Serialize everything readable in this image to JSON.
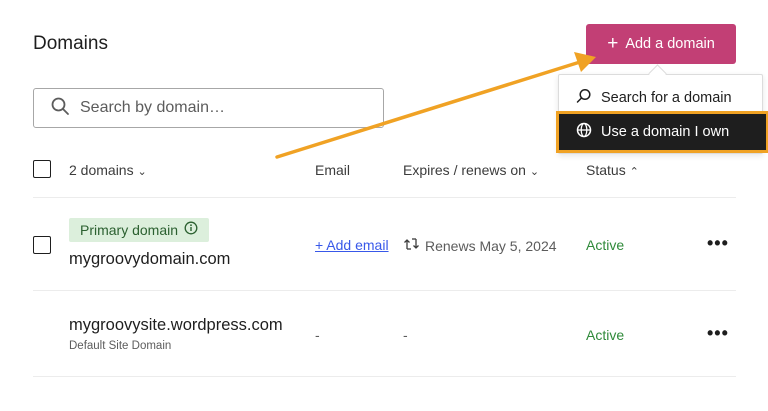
{
  "page": {
    "title": "Domains"
  },
  "add_button": {
    "label": "Add a domain",
    "icon": "plus-icon",
    "color": "#c23f75"
  },
  "search": {
    "placeholder": "Search by domain…",
    "value": ""
  },
  "dropdown": {
    "items": [
      {
        "label": "Search for a domain",
        "icon": "search-icon"
      },
      {
        "label": "Use a domain I own",
        "icon": "globe-icon",
        "highlighted": true
      }
    ],
    "highlight_color": "#f0a224"
  },
  "table": {
    "headers": {
      "domains": "2 domains",
      "email": "Email",
      "expires": "Expires / renews on",
      "status": "Status"
    },
    "rows": [
      {
        "badge": "Primary domain",
        "domain": "mygroovydomain.com",
        "email": "+ Add email",
        "renews": "Renews May 5, 2024",
        "status": "Active",
        "more": "•••"
      },
      {
        "domain": "mygroovysite.wordpress.com",
        "subtitle": "Default Site Domain",
        "email": "-",
        "renews": "-",
        "status": "Active",
        "more": "•••"
      }
    ]
  },
  "annotation": {
    "arrow_color": "#f0a224"
  }
}
